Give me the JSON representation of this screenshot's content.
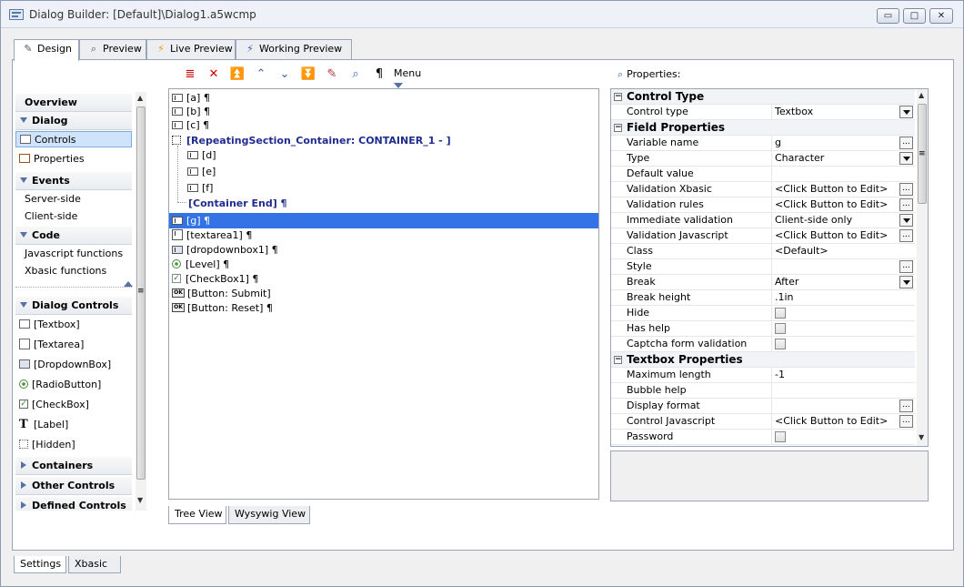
{
  "window": {
    "title": "Dialog Builder: [Default]\\Dialog1.a5wcmp",
    "min_glyph": "▭",
    "max_glyph": "□",
    "close_glyph": "✕"
  },
  "tabs": [
    {
      "label": "Design",
      "icon": "pencil-ruler-icon"
    },
    {
      "label": "Preview",
      "icon": "magnifier-icon"
    },
    {
      "label": "Live Preview",
      "icon": "lightning-icon"
    },
    {
      "label": "Working Preview",
      "icon": "lightning-icon"
    }
  ],
  "toolbar": {
    "icons": [
      "delete-list-icon",
      "delete-icon",
      "move-top-icon",
      "move-up-icon",
      "move-down-icon",
      "move-bottom-icon",
      "wand-icon",
      "find-icon",
      "pilcrow-icon"
    ],
    "glyphs": [
      "≣",
      "✕",
      "⏫",
      "⌃",
      "⌄",
      "⏬",
      "✎",
      "⌕",
      "¶"
    ],
    "menu_label": "Menu"
  },
  "left_nav": {
    "overview": "Overview",
    "dialog": "Dialog",
    "controls": "Controls",
    "properties": "Properties",
    "events": "Events",
    "server_side": "Server-side",
    "client_side": "Client-side",
    "code": "Code",
    "js_functions": "Javascript functions",
    "xbasic_functions": "Xbasic functions",
    "dialog_controls": "Dialog Controls",
    "controls_list": [
      {
        "label": "[Textbox]",
        "icon": "textbox-icon"
      },
      {
        "label": "[Textarea]",
        "icon": "textarea-icon"
      },
      {
        "label": "[DropdownBox]",
        "icon": "dropdown-icon"
      },
      {
        "label": "[RadioButton]",
        "icon": "radio-icon"
      },
      {
        "label": "[CheckBox]",
        "icon": "checkbox-icon"
      },
      {
        "label": "[Label]",
        "icon": "label-icon"
      },
      {
        "label": "[Hidden]",
        "icon": "hidden-icon"
      }
    ],
    "containers": "Containers",
    "other_controls": "Other Controls",
    "defined_controls": "Defined Controls"
  },
  "tree": {
    "rows": [
      {
        "text": "[a] ¶",
        "icon": "textbox-icon"
      },
      {
        "text": "[b] ¶",
        "icon": "textbox-icon"
      },
      {
        "text": "[c] ¶",
        "icon": "textbox-icon"
      },
      {
        "text": "[RepeatingSection_Container: CONTAINER_1 - ]",
        "icon": "container-icon"
      },
      {
        "text": "[d]",
        "icon": "textbox-icon"
      },
      {
        "text": "[e]",
        "icon": "textbox-icon"
      },
      {
        "text": "[f]",
        "icon": "textbox-icon"
      },
      {
        "text": "[Container End] ¶",
        "icon": ""
      },
      {
        "text": "[g] ¶",
        "icon": "textbox-icon"
      },
      {
        "text": "[textarea1] ¶",
        "icon": "textarea-icon"
      },
      {
        "text": "[dropdownbox1] ¶",
        "icon": "dropdown-icon"
      },
      {
        "text": "[Level] ¶",
        "icon": "radio-icon"
      },
      {
        "text": "[CheckBox1] ¶",
        "icon": "checkbox-icon"
      },
      {
        "text": "[Button: Submit]",
        "icon": "ok-button-icon"
      },
      {
        "text": "[Button: Reset] ¶",
        "icon": "ok-button-icon"
      }
    ],
    "selected_index": 8,
    "view_tabs": [
      "Tree View",
      "Wysywig View"
    ]
  },
  "properties": {
    "title": "Properties:",
    "rows": [
      {
        "type": "cat",
        "name": "Control Type"
      },
      {
        "type": "prop",
        "name": "Control type",
        "value": "Textbox",
        "editor": "dropdown"
      },
      {
        "type": "cat",
        "name": "Field Properties"
      },
      {
        "type": "prop",
        "name": "Variable name",
        "value": "g",
        "editor": "ellipsis"
      },
      {
        "type": "prop",
        "name": "Type",
        "value": "Character",
        "editor": "dropdown"
      },
      {
        "type": "prop",
        "name": "Default value",
        "value": "",
        "editor": ""
      },
      {
        "type": "prop",
        "name": "Validation Xbasic",
        "value": "<Click Button to Edit>",
        "editor": "ellipsis"
      },
      {
        "type": "prop",
        "name": "Validation rules",
        "value": "<Click Button to Edit>",
        "editor": "ellipsis"
      },
      {
        "type": "prop",
        "name": "Immediate validation",
        "value": "Client-side only",
        "editor": "dropdown"
      },
      {
        "type": "prop",
        "name": "Validation Javascript",
        "value": "<Click Button to Edit>",
        "editor": "ellipsis"
      },
      {
        "type": "prop",
        "name": "Class",
        "value": "<Default>",
        "editor": ""
      },
      {
        "type": "prop",
        "name": "Style",
        "value": "",
        "editor": "ellipsis"
      },
      {
        "type": "prop",
        "name": "Break",
        "value": "After",
        "editor": "dropdown"
      },
      {
        "type": "prop",
        "name": "Break height",
        "value": ".1in",
        "editor": ""
      },
      {
        "type": "prop",
        "name": "Hide",
        "value": "",
        "editor": "checkbox"
      },
      {
        "type": "prop",
        "name": "Has help",
        "value": "",
        "editor": "checkbox"
      },
      {
        "type": "prop",
        "name": "Captcha form validation",
        "value": "",
        "editor": "checkbox"
      },
      {
        "type": "cat",
        "name": "Textbox Properties"
      },
      {
        "type": "prop",
        "name": "Maximum length",
        "value": "-1",
        "editor": ""
      },
      {
        "type": "prop",
        "name": "Bubble help",
        "value": "",
        "editor": ""
      },
      {
        "type": "prop",
        "name": "Display format",
        "value": "",
        "editor": "ellipsis"
      },
      {
        "type": "prop",
        "name": "Control Javascript",
        "value": "<Click Button to Edit>",
        "editor": "ellipsis"
      },
      {
        "type": "prop",
        "name": "Password",
        "value": "",
        "editor": "checkbox"
      }
    ]
  },
  "bottom_tabs": [
    "Settings",
    "Xbasic"
  ]
}
